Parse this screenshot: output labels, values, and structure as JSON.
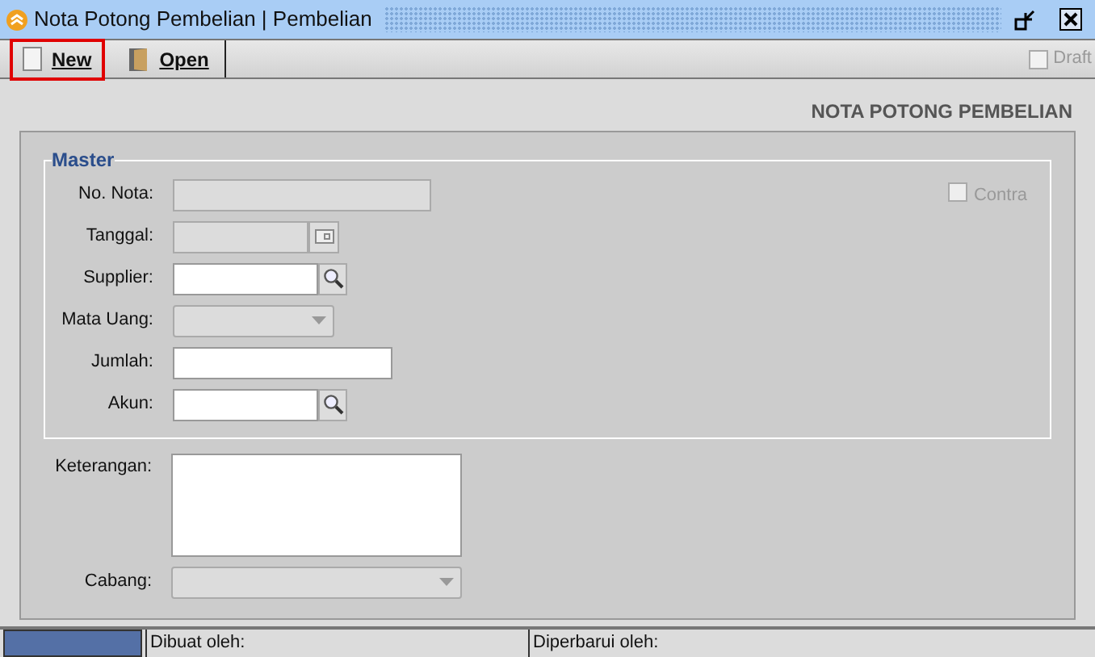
{
  "window": {
    "title": "Nota Potong Pembelian | Pembelian"
  },
  "toolbar": {
    "buttons": [
      {
        "label": "New",
        "kind": "new",
        "highlighted": true
      },
      {
        "label": "Open",
        "kind": "open",
        "highlighted": false
      }
    ],
    "draft": {
      "label": "Draft",
      "checked": false,
      "disabled": true
    }
  },
  "heading": "NOTA POTONG PEMBELIAN",
  "master": {
    "legend": "Master",
    "contra": {
      "label": "Contra",
      "checked": false,
      "disabled": true
    },
    "fields": [
      {
        "label": "No. Nota:",
        "kind": "text",
        "disabled": true
      },
      {
        "label": "Tanggal:",
        "kind": "date",
        "disabled": true
      },
      {
        "label": "Supplier:",
        "kind": "lookup",
        "disabled": false
      },
      {
        "label": "Mata Uang:",
        "kind": "select",
        "disabled": true
      },
      {
        "label": "Jumlah:",
        "kind": "text",
        "disabled": false
      },
      {
        "label": "Akun:",
        "kind": "lookup",
        "disabled": false
      }
    ]
  },
  "fields": [
    {
      "label": "Keterangan:",
      "kind": "textarea",
      "disabled": false
    },
    {
      "label": "Cabang:",
      "kind": "select",
      "disabled": true
    }
  ],
  "status_bar": [
    "Dibuat oleh:",
    "Diperbarui oleh:"
  ]
}
